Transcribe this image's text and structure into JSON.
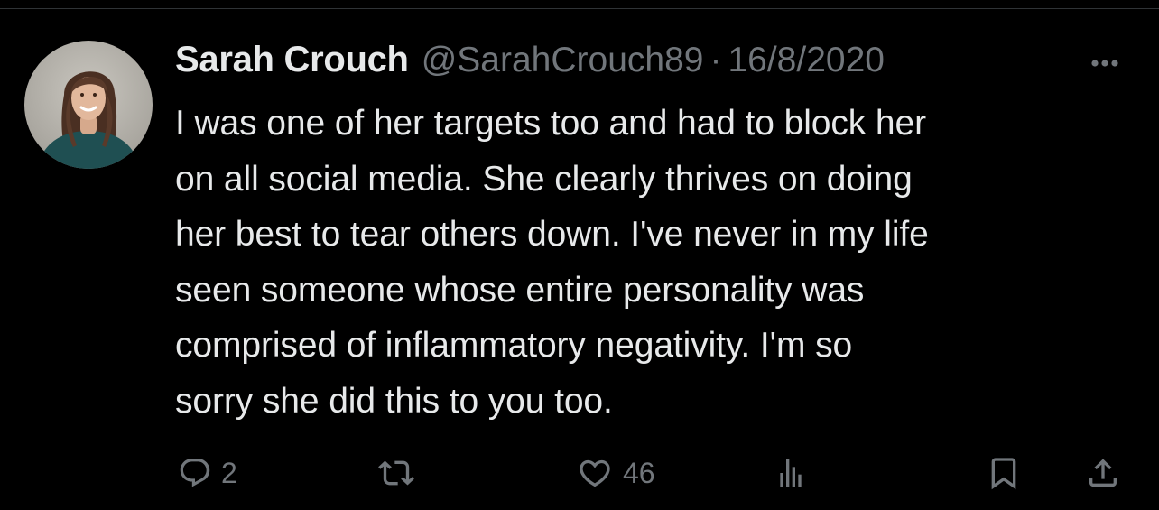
{
  "tweet": {
    "author_name": "Sarah Crouch",
    "handle": "@SarahCrouch89",
    "separator": "·",
    "date": "16/8/2020",
    "text": "I was one of her targets too and had to block her\non all social media. She clearly thrives on doing\nher best to tear others down. I've never in my life\nseen someone whose entire personality was\ncomprised of inflammatory negativity. I'm so\nsorry she did this to you too."
  },
  "actions": {
    "reply": {
      "icon": "reply-icon",
      "count": "2"
    },
    "retweet": {
      "icon": "retweet-icon"
    },
    "like": {
      "icon": "heart-icon",
      "count": "46"
    },
    "views": {
      "icon": "analytics-icon"
    },
    "bookmark": {
      "icon": "bookmark-icon"
    },
    "share": {
      "icon": "share-icon"
    },
    "more": {
      "icon": "more-icon"
    }
  },
  "colors": {
    "background": "#000000",
    "text_primary": "#e7e9ea",
    "text_secondary": "#71767b",
    "divider": "#2f3336"
  }
}
